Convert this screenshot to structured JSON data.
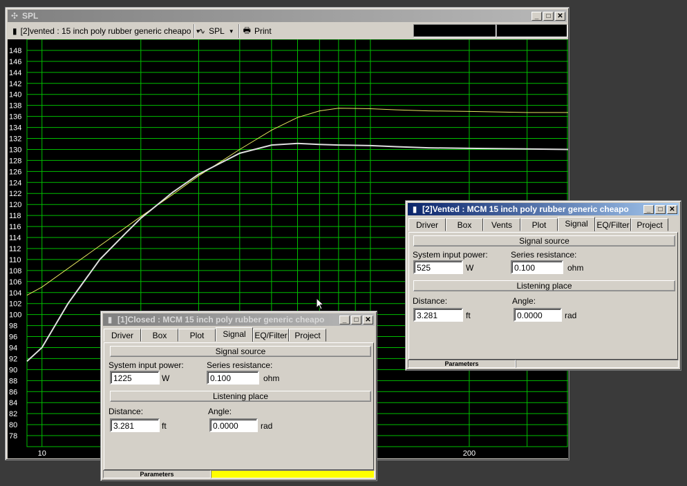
{
  "spl_window": {
    "title": "SPL",
    "toolbar": {
      "project_select": "[2]vented : 15 inch poly rubber generic cheapo",
      "view_select": "SPL",
      "print_label": "Print"
    }
  },
  "chart_data": {
    "type": "line",
    "title": "",
    "xlabel": "",
    "ylabel": "",
    "x_scale": "log",
    "xlim": [
      9,
      400
    ],
    "ylim": [
      76,
      150
    ],
    "y_ticks": [
      148,
      146,
      144,
      142,
      140,
      138,
      136,
      134,
      132,
      130,
      128,
      126,
      124,
      122,
      120,
      118,
      116,
      114,
      112,
      110,
      108,
      106,
      104,
      102,
      100,
      98,
      96,
      94,
      92,
      90,
      88,
      86,
      84,
      82,
      80,
      78
    ],
    "x_tick_labels": [
      {
        "x": 10,
        "label": "10"
      },
      {
        "x": 200,
        "label": "200"
      }
    ],
    "x_gridlines": [
      10,
      20,
      30,
      40,
      50,
      60,
      70,
      80,
      90,
      100,
      200,
      300
    ],
    "background": "#000000",
    "grid_color": "#00c000",
    "series": [
      {
        "color": "#e8e860",
        "x": [
          9,
          10,
          15,
          20,
          25,
          30,
          40,
          50,
          60,
          70,
          80,
          100,
          120,
          150,
          200,
          300,
          400
        ],
        "y": [
          103.5,
          105.0,
          112.5,
          117.8,
          121.8,
          125.2,
          130.0,
          133.5,
          135.8,
          137.0,
          137.5,
          137.4,
          137.2,
          137.0,
          136.9,
          136.7,
          136.7
        ]
      },
      {
        "color": "#e0e0e0",
        "x": [
          9,
          10,
          12,
          15,
          18,
          20,
          25,
          30,
          40,
          50,
          60,
          70,
          80,
          100,
          120,
          150,
          200,
          300,
          400
        ],
        "y": [
          91.5,
          94.0,
          102.0,
          110.0,
          114.8,
          117.5,
          122.2,
          125.5,
          129.3,
          130.8,
          131.1,
          130.9,
          130.8,
          130.7,
          130.5,
          130.3,
          130.2,
          130.1,
          130.0
        ]
      }
    ]
  },
  "closed_window": {
    "title": "[1]Closed : MCM 15 inch poly rubber generic cheapo",
    "tabs": [
      "Driver",
      "Box",
      "Plot",
      "Signal",
      "EQ/Filter",
      "Project"
    ],
    "selected_tab": "Signal",
    "signal_source_header": "Signal source",
    "input_power_label": "System input power:",
    "input_power_value": "1225",
    "input_power_unit": "W",
    "series_resistance_label": "Series resistance:",
    "series_resistance_value": "0.100",
    "series_resistance_unit": "ohm",
    "listening_header": "Listening place",
    "distance_label": "Distance:",
    "distance_value": "3.281",
    "distance_unit": "ft",
    "angle_label": "Angle:",
    "angle_value": "0.0000",
    "angle_unit": "rad",
    "status_label": "Parameters",
    "status_color": "#ffff00"
  },
  "vented_window": {
    "title": "[2]Vented : MCM 15 inch poly rubber generic cheapo",
    "tabs": [
      "Driver",
      "Box",
      "Vents",
      "Plot",
      "Signal",
      "EQ/Filter",
      "Project"
    ],
    "selected_tab": "Signal",
    "signal_source_header": "Signal source",
    "input_power_label": "System input power:",
    "input_power_value": "525",
    "input_power_unit": "W",
    "series_resistance_label": "Series resistance:",
    "series_resistance_value": "0.100",
    "series_resistance_unit": "ohm",
    "listening_header": "Listening place",
    "distance_label": "Distance:",
    "distance_value": "3.281",
    "distance_unit": "ft",
    "angle_label": "Angle:",
    "angle_value": "0.0000",
    "angle_unit": "rad",
    "status_label": "Parameters"
  }
}
